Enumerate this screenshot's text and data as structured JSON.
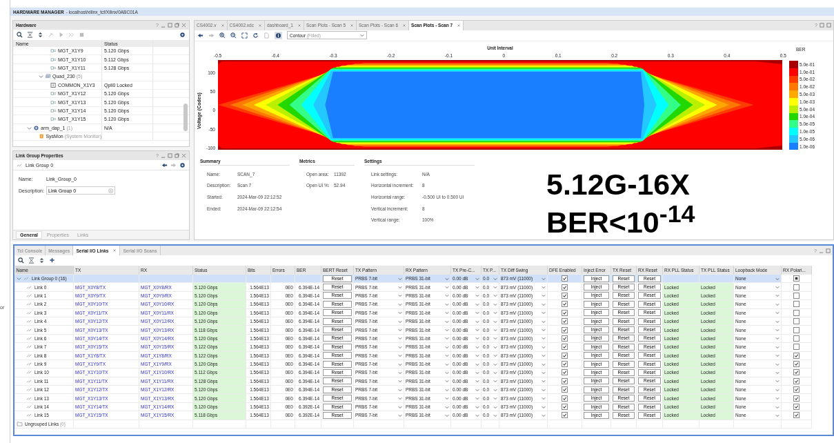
{
  "edge_text": "or",
  "window": {
    "title": "HARDWARE MANAGER",
    "subtitle": "- localhost/xilinx_tcf/Xilinx/0ABC01A"
  },
  "hardware": {
    "title": "Hardware",
    "help": "?",
    "columns": [
      "Name",
      "Status"
    ],
    "tree": [
      {
        "children": [
          {
            "children": [
              {
                "label": "MGT_X1Y9",
                "kind": "channel",
                "status": "5.120 Gbps"
              },
              {
                "label": "MGT_X1Y10",
                "kind": "channel",
                "status": "5.112 Gbps"
              },
              {
                "label": "MGT_X1Y11",
                "kind": "channel",
                "status": "5.128 Gbps"
              }
            ]
          },
          {
            "label": "Quad_230",
            "count": "(5)",
            "kind": "quad",
            "expanded": true,
            "children": [
              {
                "label": "COMMON_X1Y3",
                "kind": "common",
                "status": "Qpll0 Locked"
              },
              {
                "label": "MGT_X1Y12",
                "kind": "channel",
                "status": "5.120 Gbps"
              },
              {
                "label": "MGT_X1Y13",
                "kind": "channel",
                "status": "5.120 Gbps"
              },
              {
                "label": "MGT_X1Y14",
                "kind": "channel",
                "status": "5.120 Gbps"
              },
              {
                "label": "MGT_X1Y15",
                "kind": "channel",
                "status": "5.120 Gbps"
              }
            ]
          }
        ]
      },
      {
        "label": "arm_dap_1",
        "count": "(1)",
        "kind": "device",
        "expanded": true,
        "status": "N/A",
        "children": [
          {
            "label": "SysMon",
            "count": "(System Monitor)",
            "kind": "sysmon"
          }
        ]
      }
    ]
  },
  "properties": {
    "title": "Link Group Properties",
    "help": "?",
    "item": "Link Group 0",
    "name_label": "Name:",
    "name_value": "Link_Group_0",
    "description_label": "Description:",
    "description_value": "Link Group 0",
    "tabs": [
      {
        "label": "General",
        "selected": true
      },
      {
        "label": "Properties",
        "selected": false
      },
      {
        "label": "Links",
        "selected": false
      }
    ]
  },
  "editor": {
    "help": "?",
    "tabs": [
      {
        "label": "CS4002.v",
        "selected": false
      },
      {
        "label": "CS4002.xdc",
        "selected": false
      },
      {
        "label": "dashboard_1",
        "selected": false
      },
      {
        "label": "Scan Plots - Scan 5",
        "selected": false
      },
      {
        "label": "Scan Plots - Scan 6",
        "selected": false
      },
      {
        "label": "Scan Plots - Scan 7",
        "selected": true
      }
    ],
    "plot_type": "Contour",
    "plot_type_note": "(Filled)",
    "plot": {
      "title": "Unit Interval",
      "ylabel": "Voltage (Codes)",
      "xticks": [
        "-0.5",
        "-0.4",
        "-0.3",
        "-0.2",
        "-0.1",
        "0",
        "0.1",
        "0.2",
        "0.3",
        "0.4",
        "0.5"
      ],
      "yticks": [
        "100",
        "50",
        "0",
        "-50",
        "-100"
      ],
      "legend_title": "BER",
      "legend": [
        {
          "label": "5.0e-01",
          "color": "#a80000"
        },
        {
          "label": "1.0e-01",
          "color": "#ff0000"
        },
        {
          "label": "5.0e-02",
          "color": "#ff3c00"
        },
        {
          "label": "1.0e-02",
          "color": "#ff7800"
        },
        {
          "label": "5.0e-03",
          "color": "#ffa800"
        },
        {
          "label": "1.0e-03",
          "color": "#ffff00"
        },
        {
          "label": "5.0e-04",
          "color": "#b8f000"
        },
        {
          "label": "1.0e-04",
          "color": "#22d800"
        },
        {
          "label": "5.0e-05",
          "color": "#33ff88"
        },
        {
          "label": "1.0e-05",
          "color": "#00ffff"
        },
        {
          "label": "5.0e-06",
          "color": "#22c8ff"
        },
        {
          "label": "1.0e-06",
          "color": "#1a7fff"
        }
      ]
    },
    "sections": [
      {
        "title": "Summary",
        "items": [
          {
            "label": "Name:",
            "value": "SCAN_7"
          },
          {
            "label": "Description:",
            "value": "Scan 7"
          },
          {
            "label": "Started:",
            "value": "2024-Mar-09 22:12:52"
          },
          {
            "label": "Ended:",
            "value": "2024-Mar-09 22:12:54"
          }
        ]
      },
      {
        "title": "Metrics",
        "items": [
          {
            "label": "Open area:",
            "value": "11392"
          },
          {
            "label": "Open UI %:",
            "value": "52.94"
          }
        ]
      },
      {
        "title": "Settings",
        "items": [
          {
            "label": "Link settings:",
            "value": "N/A"
          },
          {
            "label": "Horizontal increment:",
            "value": "8"
          },
          {
            "label": "Horizontal range:",
            "value": "-0.500 UI to 0.500 UI"
          },
          {
            "label": "Vertical increment:",
            "value": "8"
          },
          {
            "label": "Vertical range:",
            "value": "100%"
          }
        ]
      }
    ],
    "overlay": [
      "5.12G-16X",
      "BER<10$^{-14}$"
    ]
  },
  "serial_io": {
    "help": "?",
    "tabs": [
      {
        "label": "Tcl Console",
        "selected": false
      },
      {
        "label": "Messages",
        "selected": false
      },
      {
        "label": "Serial I/O Links",
        "selected": true
      },
      {
        "label": "Serial I/O Scans",
        "selected": false
      }
    ],
    "columns": [
      "Name",
      "TX",
      "RX",
      "Status",
      "Bits",
      "Errors",
      "BER",
      "BERT Reset",
      "TX Pattern",
      "RX Pattern",
      "TX Pre-C...",
      "TX P...",
      "TX Diff Swing",
      "DFE Enabled",
      "Inject Error",
      "TX Reset",
      "RX Reset",
      "RX PLL Status",
      "TX PLL Status",
      "Loopback Mode",
      "RX Polari..."
    ],
    "group": {
      "name": "Link Group 0",
      "count": "(16)",
      "selected": true,
      "bert_reset": "Reset",
      "tx_pattern": "PRBS 7-bit",
      "rx_pattern": "PRBS 31-bit",
      "tx_pre_cursor": "0.00 dB",
      "tx_post_cursor": "0.0",
      "tx_diff_swing": "873 mV (11000)",
      "dfe_enabled": true,
      "inject_error": "Inject",
      "tx_reset": "Reset",
      "rx_reset": "Reset",
      "loopback_mode": "None",
      "rx_polarity_mixed": true
    },
    "links": [
      {
        "name": "Link 0",
        "tx": "MGT_X0Y8/TX",
        "rx": "MGT_X0Y8/RX",
        "status": "5.120 Gbps",
        "bits": "1.564E13",
        "errors": "0E0",
        "ber": "6.394E-14",
        "bert_reset": "Reset",
        "tx_pattern": "PRBS 7-bit",
        "rx_pattern": "PRBS 31-bit",
        "tx_pre_cursor": "0.00 dB",
        "tx_post_cursor": "0.0",
        "tx_diff_swing": "873 mV (11000)",
        "dfe_enabled": true,
        "inject_error": "Inject",
        "tx_reset": "Reset",
        "rx_reset": "Reset",
        "rx_pll_status": "Locked",
        "tx_pll_status": "Locked",
        "loopback_mode": "None",
        "rx_polarity": false
      },
      {
        "name": "Link 1",
        "tx": "MGT_X0Y9/TX",
        "rx": "MGT_X0Y9/RX",
        "status": "5.120 Gbps",
        "bits": "1.564E13",
        "errors": "0E0",
        "ber": "6.394E-14",
        "bert_reset": "Reset",
        "tx_pattern": "PRBS 7-bit",
        "rx_pattern": "PRBS 31-bit",
        "tx_pre_cursor": "0.00 dB",
        "tx_post_cursor": "0.0",
        "tx_diff_swing": "873 mV (11000)",
        "dfe_enabled": true,
        "inject_error": "Inject",
        "tx_reset": "Reset",
        "rx_reset": "Reset",
        "rx_pll_status": "Locked",
        "tx_pll_status": "Locked",
        "loopback_mode": "None",
        "rx_polarity": false
      },
      {
        "name": "Link 2",
        "tx": "MGT_X0Y10/TX",
        "rx": "MGT_X0Y10/RX",
        "status": "5.120 Gbps",
        "bits": "1.564E13",
        "errors": "0E0",
        "ber": "6.394E-14",
        "bert_reset": "Reset",
        "tx_pattern": "PRBS 7-bit",
        "rx_pattern": "PRBS 31-bit",
        "tx_pre_cursor": "0.00 dB",
        "tx_post_cursor": "0.0",
        "tx_diff_swing": "873 mV (11000)",
        "dfe_enabled": true,
        "inject_error": "Inject",
        "tx_reset": "Reset",
        "rx_reset": "Reset",
        "rx_pll_status": "Locked",
        "tx_pll_status": "Locked",
        "loopback_mode": "None",
        "rx_polarity": false
      },
      {
        "name": "Link 3",
        "tx": "MGT_X0Y11/TX",
        "rx": "MGT_X0Y11/RX",
        "status": "5.120 Gbps",
        "bits": "1.564E13",
        "errors": "0E0",
        "ber": "6.394E-14",
        "bert_reset": "Reset",
        "tx_pattern": "PRBS 7-bit",
        "rx_pattern": "PRBS 31-bit",
        "tx_pre_cursor": "0.00 dB",
        "tx_post_cursor": "0.0",
        "tx_diff_swing": "873 mV (11000)",
        "dfe_enabled": true,
        "inject_error": "Inject",
        "tx_reset": "Reset",
        "rx_reset": "Reset",
        "rx_pll_status": "Locked",
        "tx_pll_status": "Locked",
        "loopback_mode": "None",
        "rx_polarity": false
      },
      {
        "name": "Link 4",
        "tx": "MGT_X0Y12/TX",
        "rx": "MGT_X0Y12/RX",
        "status": "5.120 Gbps",
        "bits": "1.564E13",
        "errors": "0E0",
        "ber": "6.394E-14",
        "bert_reset": "Reset",
        "tx_pattern": "PRBS 7-bit",
        "rx_pattern": "PRBS 31-bit",
        "tx_pre_cursor": "0.00 dB",
        "tx_post_cursor": "0.0",
        "tx_diff_swing": "873 mV (11000)",
        "dfe_enabled": true,
        "inject_error": "Inject",
        "tx_reset": "Reset",
        "rx_reset": "Reset",
        "rx_pll_status": "Locked",
        "tx_pll_status": "Locked",
        "loopback_mode": "None",
        "rx_polarity": false
      },
      {
        "name": "Link 5",
        "tx": "MGT_X0Y13/TX",
        "rx": "MGT_X0Y13/RX",
        "status": "5.118 Gbps",
        "bits": "1.564E13",
        "errors": "0E0",
        "ber": "6.394E-14",
        "bert_reset": "Reset",
        "tx_pattern": "PRBS 7-bit",
        "rx_pattern": "PRBS 31-bit",
        "tx_pre_cursor": "0.00 dB",
        "tx_post_cursor": "0.0",
        "tx_diff_swing": "873 mV (11000)",
        "dfe_enabled": true,
        "inject_error": "Inject",
        "tx_reset": "Reset",
        "rx_reset": "Reset",
        "rx_pll_status": "Locked",
        "tx_pll_status": "Locked",
        "loopback_mode": "None",
        "rx_polarity": false
      },
      {
        "name": "Link 6",
        "tx": "MGT_X0Y14/TX",
        "rx": "MGT_X0Y14/RX",
        "status": "5.120 Gbps",
        "bits": "1.564E13",
        "errors": "0E0",
        "ber": "6.394E-14",
        "bert_reset": "Reset",
        "tx_pattern": "PRBS 7-bit",
        "rx_pattern": "PRBS 31-bit",
        "tx_pre_cursor": "0.00 dB",
        "tx_post_cursor": "0.0",
        "tx_diff_swing": "873 mV (11000)",
        "dfe_enabled": true,
        "inject_error": "Inject",
        "tx_reset": "Reset",
        "rx_reset": "Reset",
        "rx_pll_status": "Locked",
        "tx_pll_status": "Locked",
        "loopback_mode": "None",
        "rx_polarity": false
      },
      {
        "name": "Link 7",
        "tx": "MGT_X0Y15/TX",
        "rx": "MGT_X0Y15/RX",
        "status": "5.122 Gbps",
        "bits": "1.564E13",
        "errors": "0E0",
        "ber": "6.394E-14",
        "bert_reset": "Reset",
        "tx_pattern": "PRBS 7-bit",
        "rx_pattern": "PRBS 31-bit",
        "tx_pre_cursor": "0.00 dB",
        "tx_post_cursor": "0.0",
        "tx_diff_swing": "873 mV (11000)",
        "dfe_enabled": true,
        "inject_error": "Inject",
        "tx_reset": "Reset",
        "rx_reset": "Reset",
        "rx_pll_status": "Locked",
        "tx_pll_status": "Locked",
        "loopback_mode": "None",
        "rx_polarity": false
      },
      {
        "name": "Link 8",
        "tx": "MGT_X1Y8/TX",
        "rx": "MGT_X1Y8/RX",
        "status": "5.122 Gbps",
        "bits": "1.564E13",
        "errors": "0E0",
        "ber": "6.394E-14",
        "bert_reset": "Reset",
        "tx_pattern": "PRBS 7-bit",
        "rx_pattern": "PRBS 31-bit",
        "tx_pre_cursor": "0.00 dB",
        "tx_post_cursor": "0.0",
        "tx_diff_swing": "873 mV (11000)",
        "dfe_enabled": true,
        "inject_error": "Inject",
        "tx_reset": "Reset",
        "rx_reset": "Reset",
        "rx_pll_status": "Locked",
        "tx_pll_status": "Locked",
        "loopback_mode": "None",
        "rx_polarity": true
      },
      {
        "name": "Link 9",
        "tx": "MGT_X1Y9/TX",
        "rx": "MGT_X1Y9/RX",
        "status": "5.120 Gbps",
        "bits": "1.564E13",
        "errors": "0E0",
        "ber": "6.394E-14",
        "bert_reset": "Reset",
        "tx_pattern": "PRBS 7-bit",
        "rx_pattern": "PRBS 31-bit",
        "tx_pre_cursor": "0.00 dB",
        "tx_post_cursor": "0.0",
        "tx_diff_swing": "873 mV (11000)",
        "dfe_enabled": true,
        "inject_error": "Inject",
        "tx_reset": "Reset",
        "rx_reset": "Reset",
        "rx_pll_status": "Locked",
        "tx_pll_status": "Locked",
        "loopback_mode": "None",
        "rx_polarity": true
      },
      {
        "name": "Link 10",
        "tx": "MGT_X1Y10/TX",
        "rx": "MGT_X1Y10/RX",
        "status": "5.112 Gbps",
        "bits": "1.564E13",
        "errors": "0E0",
        "ber": "6.394E-14",
        "bert_reset": "Reset",
        "tx_pattern": "PRBS 7-bit",
        "rx_pattern": "PRBS 31-bit",
        "tx_pre_cursor": "0.00 dB",
        "tx_post_cursor": "0.0",
        "tx_diff_swing": "873 mV (11000)",
        "dfe_enabled": true,
        "inject_error": "Inject",
        "tx_reset": "Reset",
        "rx_reset": "Reset",
        "rx_pll_status": "Locked",
        "tx_pll_status": "Locked",
        "loopback_mode": "None",
        "rx_polarity": true
      },
      {
        "name": "Link 11",
        "tx": "MGT_X1Y11/TX",
        "rx": "MGT_X1Y11/RX",
        "status": "5.128 Gbps",
        "bits": "1.564E13",
        "errors": "0E0",
        "ber": "6.394E-14",
        "bert_reset": "Reset",
        "tx_pattern": "PRBS 7-bit",
        "rx_pattern": "PRBS 31-bit",
        "tx_pre_cursor": "0.00 dB",
        "tx_post_cursor": "0.0",
        "tx_diff_swing": "873 mV (11000)",
        "dfe_enabled": true,
        "inject_error": "Inject",
        "tx_reset": "Reset",
        "rx_reset": "Reset",
        "rx_pll_status": "Locked",
        "tx_pll_status": "Locked",
        "loopback_mode": "None",
        "rx_polarity": true
      },
      {
        "name": "Link 12",
        "tx": "MGT_X1Y12/TX",
        "rx": "MGT_X1Y12/RX",
        "status": "5.120 Gbps",
        "bits": "1.564E13",
        "errors": "0E0",
        "ber": "6.394E-14",
        "bert_reset": "Reset",
        "tx_pattern": "PRBS 7-bit",
        "rx_pattern": "PRBS 31-bit",
        "tx_pre_cursor": "0.00 dB",
        "tx_post_cursor": "0.0",
        "tx_diff_swing": "873 mV (11000)",
        "dfe_enabled": true,
        "inject_error": "Inject",
        "tx_reset": "Reset",
        "rx_reset": "Reset",
        "rx_pll_status": "Locked",
        "tx_pll_status": "Locked",
        "loopback_mode": "None",
        "rx_polarity": true
      },
      {
        "name": "Link 13",
        "tx": "MGT_X1Y13/TX",
        "rx": "MGT_X1Y13/RX",
        "status": "5.120 Gbps",
        "bits": "1.564E13",
        "errors": "0E0",
        "ber": "6.394E-14",
        "bert_reset": "Reset",
        "tx_pattern": "PRBS 7-bit",
        "rx_pattern": "PRBS 31-bit",
        "tx_pre_cursor": "0.00 dB",
        "tx_post_cursor": "0.0",
        "tx_diff_swing": "873 mV (11000)",
        "dfe_enabled": true,
        "inject_error": "Inject",
        "tx_reset": "Reset",
        "rx_reset": "Reset",
        "rx_pll_status": "Locked",
        "tx_pll_status": "Locked",
        "loopback_mode": "None",
        "rx_polarity": true
      },
      {
        "name": "Link 14",
        "tx": "MGT_X1Y14/TX",
        "rx": "MGT_X1Y14/RX",
        "status": "5.120 Gbps",
        "bits": "1.564E13",
        "errors": "0E0",
        "ber": "6.392E-14",
        "bert_reset": "Reset",
        "tx_pattern": "PRBS 7-bit",
        "rx_pattern": "PRBS 31-bit",
        "tx_pre_cursor": "0.00 dB",
        "tx_post_cursor": "0.0",
        "tx_diff_swing": "873 mV (11000)",
        "dfe_enabled": true,
        "inject_error": "Inject",
        "tx_reset": "Reset",
        "rx_reset": "Reset",
        "rx_pll_status": "Locked",
        "tx_pll_status": "Locked",
        "loopback_mode": "None",
        "rx_polarity": true
      },
      {
        "name": "Link 15",
        "tx": "MGT_X1Y15/TX",
        "rx": "MGT_X1Y15/RX",
        "status": "5.118 Gbps",
        "bits": "1.564E13",
        "errors": "0E0",
        "ber": "6.392E-14",
        "bert_reset": "Reset",
        "tx_pattern": "PRBS 7-bit",
        "rx_pattern": "PRBS 31-bit",
        "tx_pre_cursor": "0.00 dB",
        "tx_post_cursor": "0.0",
        "tx_diff_swing": "873 mV (11000)",
        "dfe_enabled": true,
        "inject_error": "Inject",
        "tx_reset": "Reset",
        "rx_reset": "Reset",
        "rx_pll_status": "Locked",
        "tx_pll_status": "Locked",
        "loopback_mode": "None",
        "rx_polarity": true
      }
    ],
    "ungrouped": {
      "label": "Ungrouped Links",
      "count": "(0)"
    }
  }
}
